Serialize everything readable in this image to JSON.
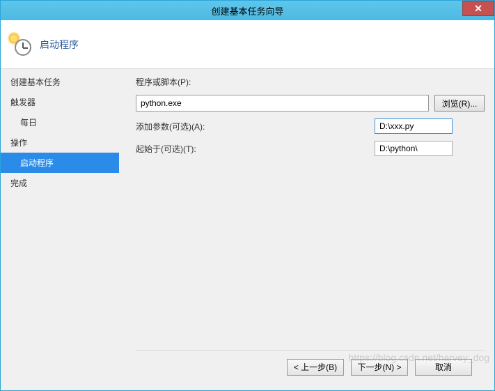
{
  "titlebar": {
    "title": "创建基本任务向导",
    "close": "✕"
  },
  "header": {
    "title": "启动程序"
  },
  "sidebar": {
    "items": [
      {
        "label": "创建基本任务",
        "sub": false,
        "selected": false
      },
      {
        "label": "触发器",
        "sub": false,
        "selected": false
      },
      {
        "label": "每日",
        "sub": true,
        "selected": false
      },
      {
        "label": "操作",
        "sub": false,
        "selected": false
      },
      {
        "label": "启动程序",
        "sub": true,
        "selected": true
      },
      {
        "label": "完成",
        "sub": false,
        "selected": false
      }
    ]
  },
  "form": {
    "script_label": "程序或脚本(P):",
    "script_value": "python.exe",
    "browse_label": "浏览(R)...",
    "args_label": "添加参数(可选)(A):",
    "args_value": "D:\\xxx.py",
    "startin_label": "起始于(可选)(T):",
    "startin_value": "D:\\python\\"
  },
  "footer": {
    "back": "< 上一步(B)",
    "next": "下一步(N) >",
    "cancel": "取消"
  },
  "watermark": "https://blog.csdn.net/harvey_dog"
}
